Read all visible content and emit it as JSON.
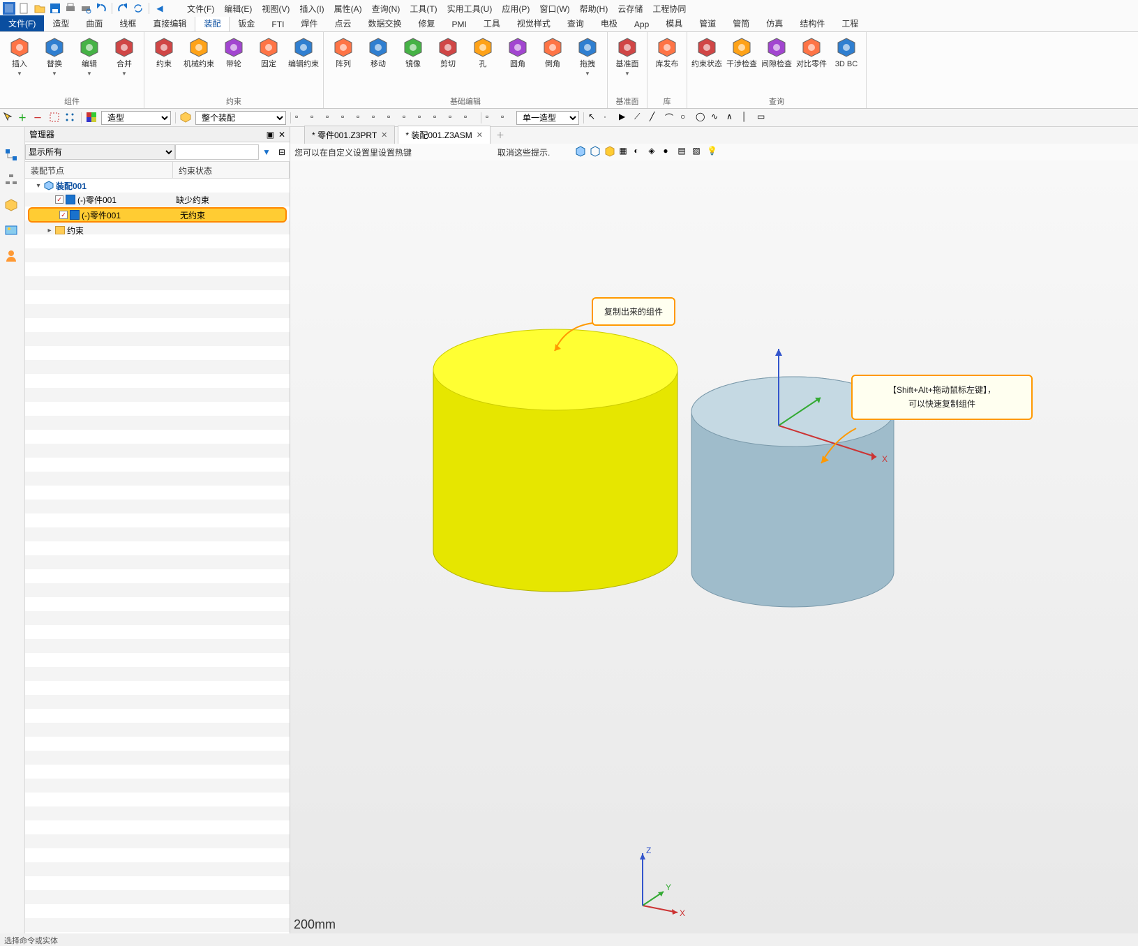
{
  "qat_icons": [
    "app-icon",
    "new-icon",
    "open-icon",
    "save-icon",
    "print-icon",
    "print-preview-icon",
    "undo-icon",
    "redo-icon",
    "refresh-icon",
    "left-icon"
  ],
  "menu": [
    "文件(F)",
    "编辑(E)",
    "视图(V)",
    "插入(I)",
    "属性(A)",
    "查询(N)",
    "工具(T)",
    "实用工具(U)",
    "应用(P)",
    "窗口(W)",
    "帮助(H)",
    "云存储",
    "工程协同"
  ],
  "tabs": [
    "文件(F)",
    "造型",
    "曲面",
    "线框",
    "直接编辑",
    "装配",
    "钣金",
    "FTI",
    "焊件",
    "点云",
    "数据交换",
    "修复",
    "PMI",
    "工具",
    "视觉样式",
    "查询",
    "电极",
    "App",
    "模具",
    "管道",
    "管筒",
    "仿真",
    "结构件",
    "工程"
  ],
  "active_tab": 5,
  "ribbon_groups": [
    {
      "label": "组件",
      "cmds": [
        {
          "label": "插入",
          "dd": true
        },
        {
          "label": "替换",
          "dd": true
        },
        {
          "label": "编辑",
          "dd": true
        },
        {
          "label": "合并",
          "dd": true
        }
      ]
    },
    {
      "label": "约束",
      "cmds": [
        {
          "label": "约束"
        },
        {
          "label": "机械约束"
        },
        {
          "label": "带轮"
        },
        {
          "label": "固定"
        },
        {
          "label": "编辑约束"
        }
      ]
    },
    {
      "label": "基础编辑",
      "cmds": [
        {
          "label": "阵列"
        },
        {
          "label": "移动"
        },
        {
          "label": "镜像"
        },
        {
          "label": "剪切"
        },
        {
          "label": "孔"
        },
        {
          "label": "圆角"
        },
        {
          "label": "倒角"
        },
        {
          "label": "拖拽",
          "dd": true
        }
      ]
    },
    {
      "label": "基准面",
      "cmds": [
        {
          "label": "基准面",
          "dd": true
        }
      ]
    },
    {
      "label": "库",
      "cmds": [
        {
          "label": "库发布"
        }
      ]
    },
    {
      "label": "查询",
      "cmds": [
        {
          "label": "约束状态"
        },
        {
          "label": "干涉检查"
        },
        {
          "label": "间隙检查"
        },
        {
          "label": "对比零件"
        },
        {
          "label": "3D BC"
        }
      ]
    }
  ],
  "filter_bar": {
    "sel1": "造型",
    "sel2": "整个装配",
    "sel3": "单一造型"
  },
  "manager": {
    "title": "管理器",
    "filter_label": "显示所有",
    "col1": "装配节点",
    "col2": "约束状态",
    "root": "装配001",
    "rows": [
      {
        "name": "(-)零件001",
        "status": "缺少约束",
        "sel": false
      },
      {
        "name": "(-)零件001",
        "status": "无约束",
        "sel": true
      }
    ],
    "folder": "约束"
  },
  "doc_tabs": [
    {
      "label": "* 零件001.Z3PRT",
      "active": false
    },
    {
      "label": "* 装配001.Z3ASM",
      "active": true
    }
  ],
  "hint_line": "您可以在自定义设置里设置热键",
  "hint_line2": "取消这些提示.",
  "callout1": "复制出来的组件",
  "callout2_l1": "【Shift+Alt+拖动鼠标左键】，",
  "callout2_l2": "可以快速复制组件",
  "axis": {
    "x": "X",
    "y": "Y",
    "z": "Z"
  },
  "scale": "200mm",
  "status": "选择命令或实体"
}
